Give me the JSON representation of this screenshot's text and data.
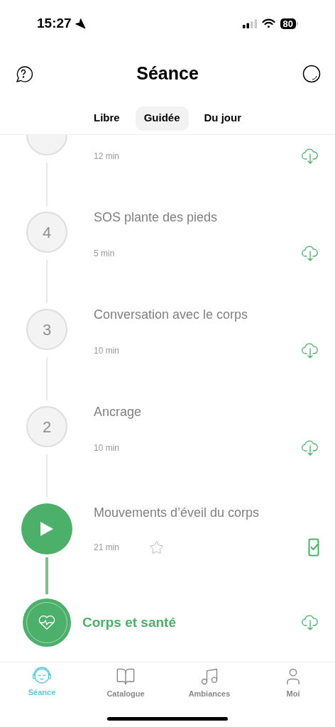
{
  "status_bar": {
    "time": "15:27",
    "battery": "80"
  },
  "header": {
    "title": "Séance"
  },
  "tabs": [
    {
      "label": "Libre",
      "selected": false
    },
    {
      "label": "Guidée",
      "selected": true
    },
    {
      "label": "Du jour",
      "selected": false
    }
  ],
  "sessions": [
    {
      "duration": "12 min",
      "current": false,
      "downloaded": false
    },
    {
      "number": "4",
      "title": "SOS plante des pieds",
      "duration": "5 min",
      "current": false,
      "downloaded": false
    },
    {
      "number": "3",
      "title": "Conversation avec le corps",
      "duration": "10 min",
      "current": false,
      "downloaded": false
    },
    {
      "number": "2",
      "title": "Ancrage",
      "duration": "10 min",
      "current": false,
      "downloaded": false
    },
    {
      "title": "Mouvements d’éveil du corps",
      "duration": "21 min",
      "current": true,
      "downloaded": true,
      "favorite": false
    }
  ],
  "category": {
    "title": "Corps et santé",
    "downloaded": false
  },
  "tab_bar": [
    {
      "label": "Séance",
      "kind": "session",
      "selected": true
    },
    {
      "label": "Catalogue",
      "kind": "catalog",
      "selected": false
    },
    {
      "label": "Ambiances",
      "kind": "music",
      "selected": false
    },
    {
      "label": "Moi",
      "kind": "profile",
      "selected": false
    }
  ]
}
